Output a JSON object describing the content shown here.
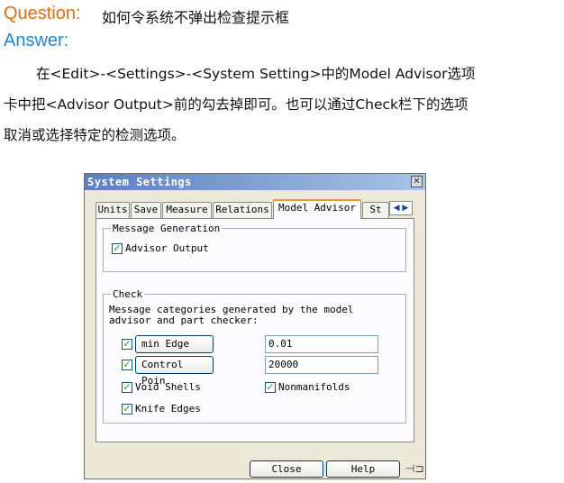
{
  "document": {
    "question_label": "Question:",
    "question_text": "如何令系统不弹出检查提示框",
    "answer_label": "Answer:",
    "paragraph": [
      "在<Edit>-<Settings>-<System Setting>中的Model Advisor选项",
      "卡中把<Advisor Output>前的勾去掉即可。也可以通过Check栏下的选项",
      "取消或选择特定的检测选项。"
    ]
  },
  "dialog": {
    "title": "System Settings",
    "close_glyph": "✕",
    "tabs": [
      "Units",
      "Save",
      "Measure",
      "Relations",
      "Model Advisor",
      "St"
    ],
    "active_tab": "Model Advisor",
    "tab_scroll_glyph": "◀ ▶",
    "message_generation": {
      "legend": "Message Generation",
      "advisor_output": {
        "label": "Advisor Output",
        "checked": true
      }
    },
    "check": {
      "legend": "Check",
      "description_line1": "Message categories generated by the model",
      "description_line2": "advisor and part checker:",
      "min_edge": {
        "label": "min Edge",
        "value": "0.01",
        "checked": true
      },
      "control_poin": {
        "label": "Control Poin",
        "value": "20000",
        "checked": true
      },
      "void_shells": {
        "label": "Void Shells",
        "checked": true
      },
      "nonmanifolds": {
        "label": "Nonmanifolds",
        "checked": true
      },
      "knife_edges": {
        "label": "Knife Edges",
        "checked": true
      }
    },
    "buttons": {
      "close": "Close",
      "help": "Help"
    },
    "pin_glyph": "⊣⊐",
    "check_glyph": "✓"
  }
}
